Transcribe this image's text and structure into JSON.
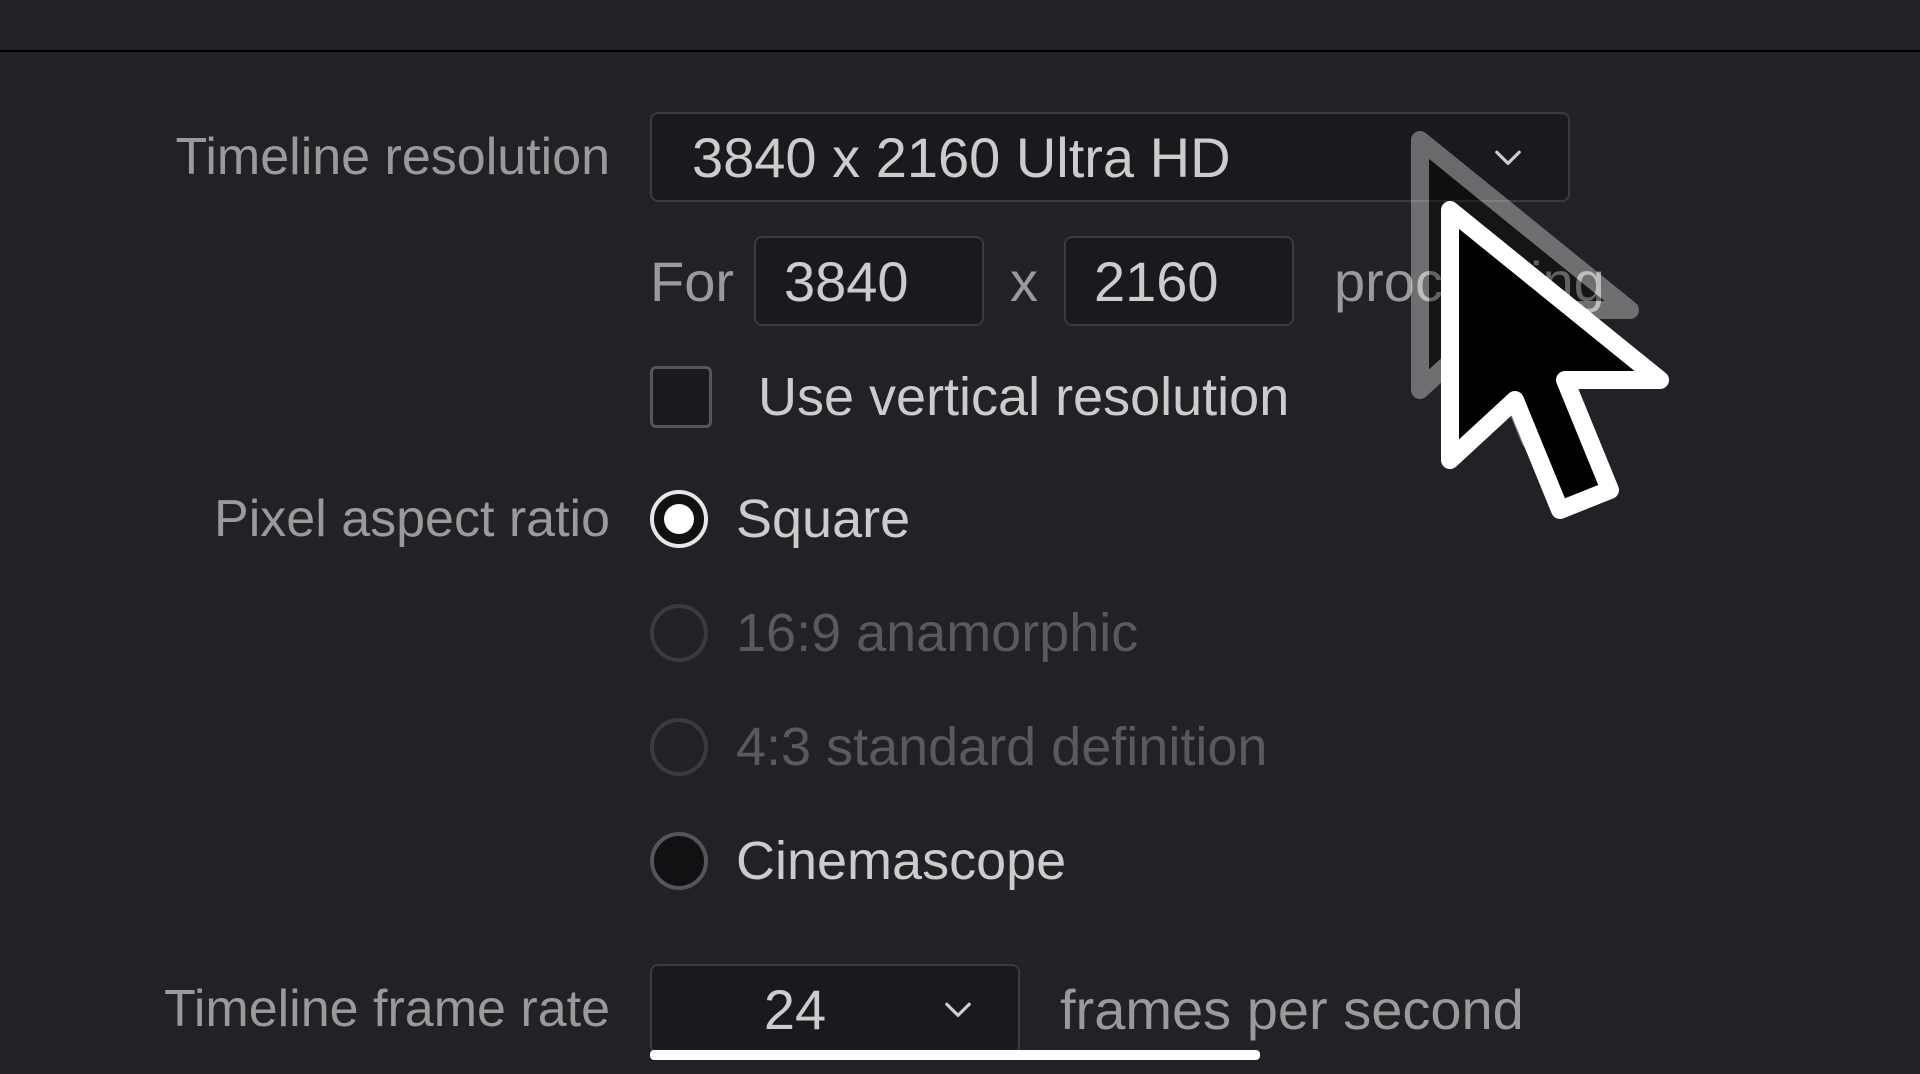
{
  "labels": {
    "timeline_resolution": "Timeline resolution",
    "pixel_aspect_ratio": "Pixel aspect ratio",
    "timeline_frame_rate": "Timeline frame rate"
  },
  "resolution": {
    "preset": "3840 x 2160 Ultra HD",
    "for_label": "For",
    "width": "3840",
    "x_label": "x",
    "height": "2160",
    "processing_label": "processing",
    "vertical_checkbox_label": "Use vertical resolution"
  },
  "par": {
    "options": {
      "square": "Square",
      "anamorphic": "16:9 anamorphic",
      "sd43": "4:3 standard definition",
      "cinemascope": "Cinemascope"
    }
  },
  "framerate": {
    "value": "24",
    "suffix": "frames per second"
  }
}
